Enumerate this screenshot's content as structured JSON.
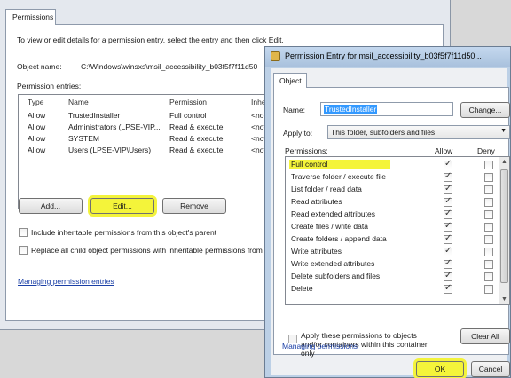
{
  "back": {
    "tab": "Permissions",
    "instructions": "To view or edit details for a permission entry, select the entry and then click Edit.",
    "object_label": "Object name:",
    "object_value": "C:\\Windows\\winsxs\\msil_accessibility_b03f5f7f11d50",
    "entries_label": "Permission entries:",
    "columns": [
      "Type",
      "Name",
      "Permission",
      "Inhe"
    ],
    "rows": [
      {
        "type": "Allow",
        "name": "TrustedInstaller",
        "permission": "Full control",
        "inherited": "<not"
      },
      {
        "type": "Allow",
        "name": "Administrators (LPSE-VIP...",
        "permission": "Read & execute",
        "inherited": "<not"
      },
      {
        "type": "Allow",
        "name": "SYSTEM",
        "permission": "Read & execute",
        "inherited": "<not"
      },
      {
        "type": "Allow",
        "name": "Users (LPSE-VIP\\Users)",
        "permission": "Read & execute",
        "inherited": "<not"
      }
    ],
    "add_label": "Add...",
    "edit_label": "Edit...",
    "remove_label": "Remove",
    "include_inheritable": "Include inheritable permissions from this object's parent",
    "replace_child": "Replace all child object permissions with inheritable permissions from t",
    "managing_link": "Managing permission entries"
  },
  "front": {
    "title": "Permission Entry for msil_accessibility_b03f5f7f11d50...",
    "tab": "Object",
    "name_label": "Name:",
    "name_value": "TrustedInstaller",
    "change_label": "Change...",
    "apply_label": "Apply to:",
    "apply_value": "This folder, subfolders and files",
    "permissions_label": "Permissions:",
    "allow_header": "Allow",
    "deny_header": "Deny",
    "permissions": [
      {
        "label": "Full control",
        "allow": true,
        "deny": false
      },
      {
        "label": "Traverse folder / execute file",
        "allow": true,
        "deny": false
      },
      {
        "label": "List folder / read data",
        "allow": true,
        "deny": false
      },
      {
        "label": "Read attributes",
        "allow": true,
        "deny": false
      },
      {
        "label": "Read extended attributes",
        "allow": true,
        "deny": false
      },
      {
        "label": "Create files / write data",
        "allow": true,
        "deny": false
      },
      {
        "label": "Create folders / append data",
        "allow": true,
        "deny": false
      },
      {
        "label": "Write attributes",
        "allow": true,
        "deny": false
      },
      {
        "label": "Write extended attributes",
        "allow": true,
        "deny": false
      },
      {
        "label": "Delete subfolders and files",
        "allow": true,
        "deny": false
      },
      {
        "label": "Delete",
        "allow": true,
        "deny": false
      }
    ],
    "apply_containers": "Apply these permissions to objects and/or containers within this container only",
    "clear_all": "Clear All",
    "managing_link": "Managing permissions",
    "ok_label": "OK",
    "cancel_label": "Cancel"
  },
  "colors": {
    "highlight": "#f4f43a",
    "link": "#1a3fa6",
    "title_bar": "#b8cde6"
  },
  "icons": [
    "shield-icon",
    "dropdown-arrow-icon",
    "scroll-up-icon",
    "scroll-down-icon"
  ]
}
